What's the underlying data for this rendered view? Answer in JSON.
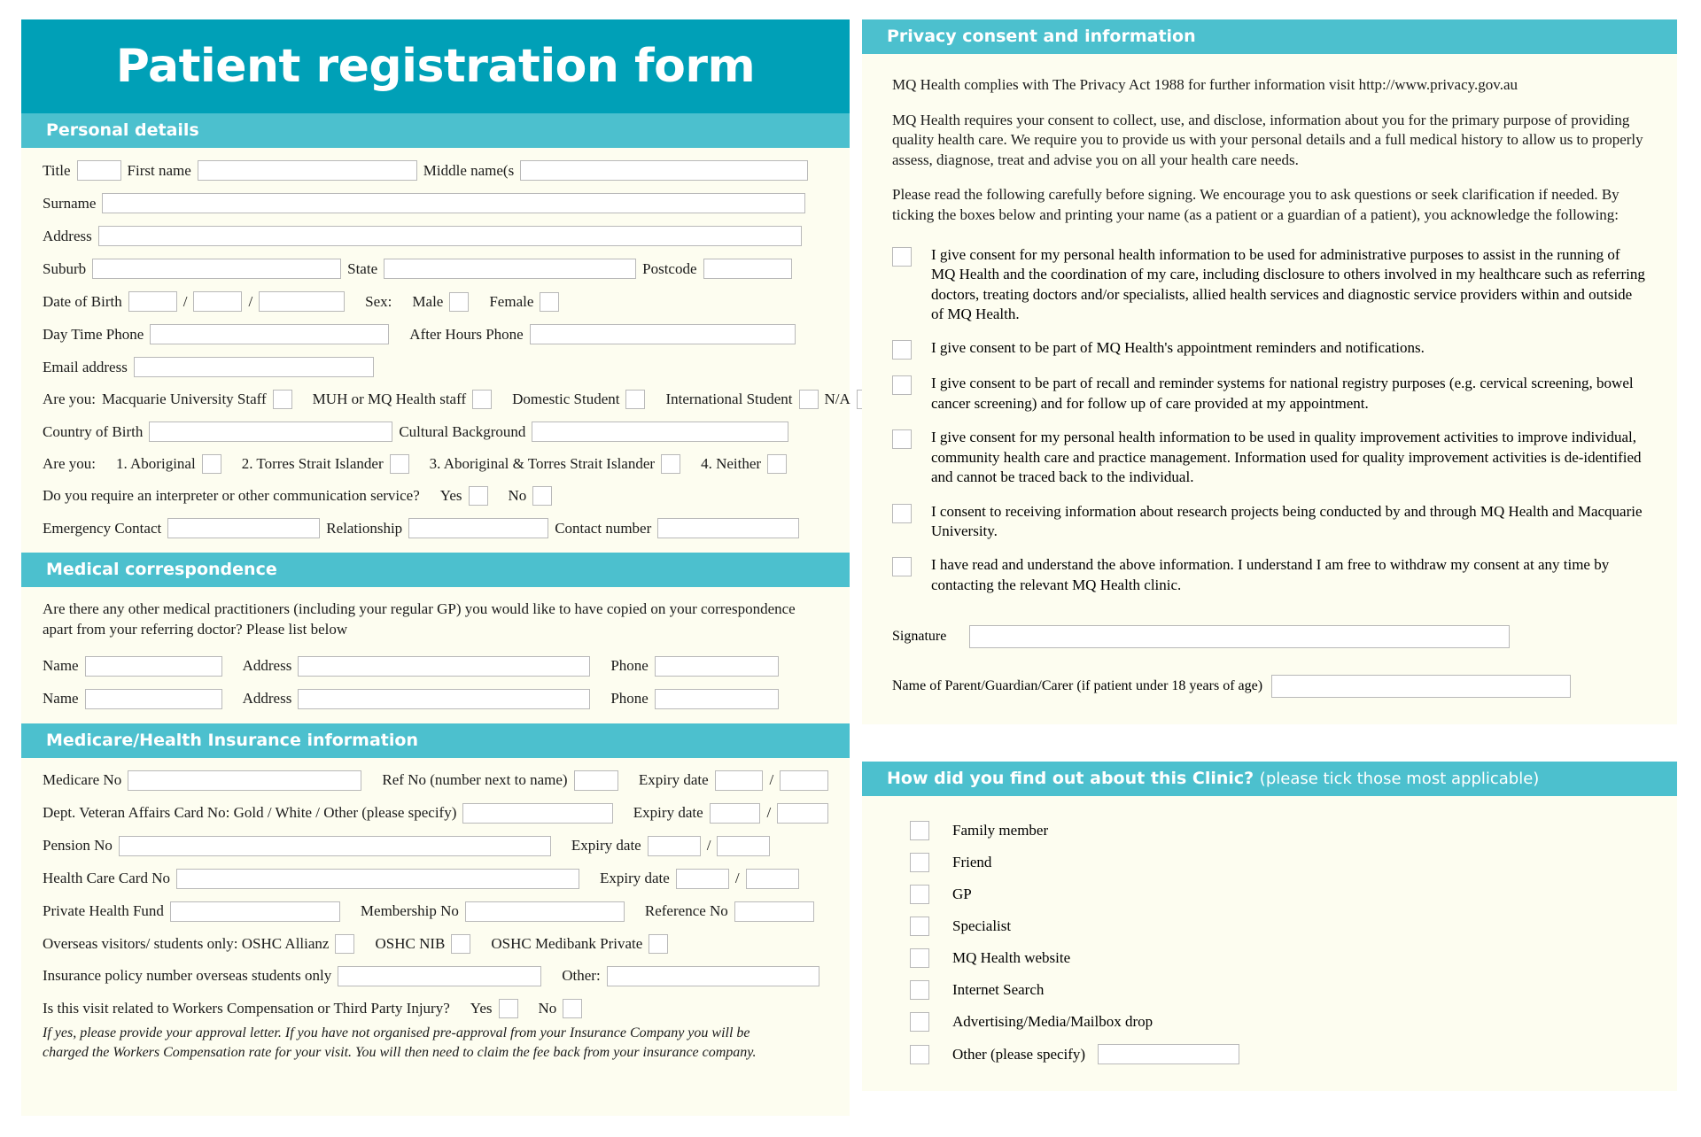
{
  "colors": {
    "title_banner": "#00a0b7",
    "section_banner": "#4cc0ce",
    "panel_bg": "#fdfdf0",
    "field_border": "#b9b9b9"
  },
  "title": "Patient registration form",
  "sections": {
    "personal": "Personal details",
    "medical_correspondence": "Medical correspondence",
    "medicare": "Medicare/Health Insurance information",
    "privacy": "Privacy consent and information",
    "find_out_main": "How did you find out about this Clinic?",
    "find_out_sub": "(please tick those most applicable)"
  },
  "personal": {
    "title": "Title",
    "first_name": "First name",
    "middle_names": "Middle name(s",
    "surname": "Surname",
    "address": "Address",
    "suburb": "Suburb",
    "state": "State",
    "postcode": "Postcode",
    "dob": "Date of Birth",
    "slash": "/",
    "sex": "Sex:",
    "male": "Male",
    "female": "Female",
    "day_phone": "Day Time Phone",
    "after_hours_phone": "After Hours Phone",
    "email": "Email address",
    "are_you": "Are you:",
    "mq_staff": "Macquarie University Staff",
    "muh_staff": "MUH or MQ Health staff",
    "domestic_student": "Domestic Student",
    "international_student": "International Student",
    "na": "N/A",
    "country_of_birth": "Country of Birth",
    "cultural_background": "Cultural Background",
    "indigenous": [
      "1. Aboriginal",
      "2. Torres Strait Islander",
      "3.  Aboriginal & Torres Strait Islander",
      "4. Neither"
    ],
    "interpreter": "Do you require an interpreter or other communication service?",
    "yes": "Yes",
    "no": "No",
    "emergency_contact": "Emergency Contact",
    "relationship": "Relationship",
    "contact_number": "Contact number"
  },
  "medical_correspondence": {
    "question": "Are there any other medical practitioners (including your regular GP) you would like to have copied on your correspondence apart from your referring doctor?  Please list below",
    "name": "Name",
    "address": "Address",
    "phone": "Phone"
  },
  "medicare": {
    "medicare_no": "Medicare No",
    "ref_no": "Ref No (number next to name)",
    "expiry": "Expiry date",
    "slash": "/",
    "dva": "Dept.  Veteran Affairs Card No:  Gold / White / Other (please specify)",
    "pension_no": "Pension No",
    "health_care_card": "Health Care Card No",
    "private_health_fund": "Private Health Fund",
    "membership_no": "Membership No",
    "reference_no": "Reference No",
    "overseas": "Overseas visitors/ students only:  OSHC Allianz",
    "oshc_nib": "OSHC NIB",
    "oshc_medibank": "OSHC Medibank Private",
    "policy_number": "Insurance policy number  overseas students only",
    "other": "Other:",
    "workers_comp": "Is this visit related to Workers Compensation or Third Party Injury?",
    "yes": "Yes",
    "no": "No",
    "disclaimer": "If yes, please provide your approval letter. If you have not organised pre-approval from your Insurance Company you will be charged the Workers Compensation rate for your visit. You will then need to claim the fee back from your insurance company."
  },
  "privacy": {
    "p1": "MQ Health complies with The Privacy Act 1988  for further information visit http://www.privacy.gov.au",
    "p2": "MQ Health requires your consent to collect, use, and disclose, information about you for the primary purpose of providing quality health care. We require you to provide us with your personal details and a full medical history to allow us to properly assess, diagnose, treat and advise you on all your health care needs.",
    "p3": "Please read the following carefully before signing. We encourage you to ask questions or seek clarification if needed. By ticking the boxes below and printing your name (as a patient or a guardian of a patient), you acknowledge the following:",
    "consents": [
      "I give consent for my personal health information to be used for administrative purposes to assist in the running of MQ Health and the coordination of my care, including disclosure to others involved in my healthcare such as referring doctors, treating doctors and/or specialists, allied health services and diagnostic service providers within and outside of MQ Health.",
      "I give consent to be part of MQ Health's appointment reminders and notifications.",
      "I give consent to be part of recall and reminder systems for national registry purposes (e.g. cervical screening, bowel cancer screening) and for follow up of care provided at my appointment.",
      "I give consent for my personal health information to be used in quality improvement activities to improve individual, community health care and practice management. Information used for quality improvement activities is de-identified and cannot be traced back to the individual.",
      "I consent to receiving information about research projects being conducted by and through MQ Health and Macquarie University.",
      "I have read and understand the above information. I understand I am free to withdraw my consent at any time by contacting the relevant MQ Health clinic."
    ],
    "signature": "Signature",
    "guardian": "Name of Parent/Guardian/Carer (if patient under 18 years of age)"
  },
  "find_out": {
    "options": [
      "Family member",
      "Friend",
      "GP",
      "Specialist",
      "MQ Health website",
      "Internet Search",
      "Advertising/Media/Mailbox drop",
      "Other (please specify)"
    ]
  }
}
